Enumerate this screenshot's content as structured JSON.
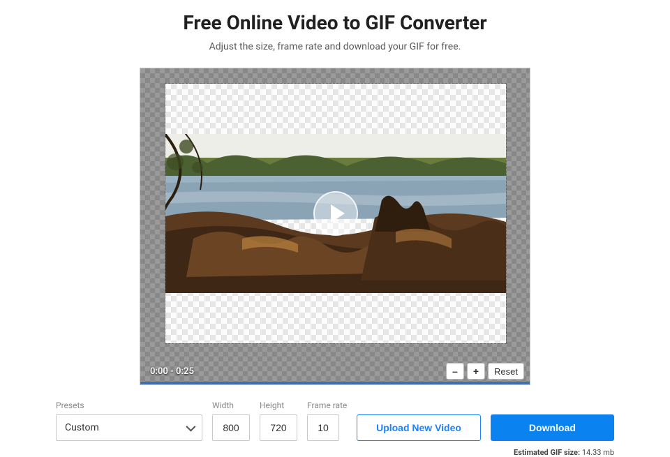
{
  "header": {
    "title": "Free Online Video to GIF Converter",
    "subtitle": "Adjust the size, frame rate and download your GIF for free."
  },
  "preview": {
    "time_range": "0:00 - 0:25",
    "zoom_out_label": "–",
    "zoom_in_label": "+",
    "reset_label": "Reset"
  },
  "controls": {
    "presets_label": "Presets",
    "presets_value": "Custom",
    "width_label": "Width",
    "width_value": "800",
    "height_label": "Height",
    "height_value": "720",
    "framerate_label": "Frame rate",
    "framerate_value": "10",
    "upload_label": "Upload New Video",
    "download_label": "Download"
  },
  "estimate": {
    "label": "Estimated GIF size:",
    "value": "14.33 mb"
  }
}
